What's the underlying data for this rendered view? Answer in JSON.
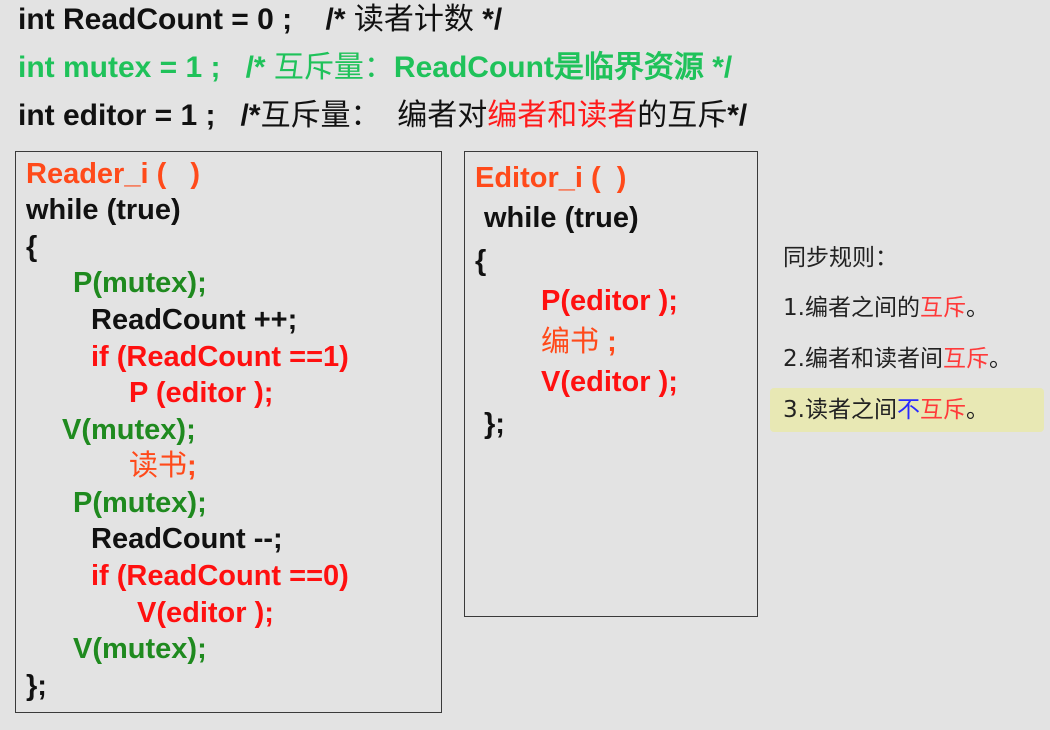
{
  "declarations": {
    "line1": {
      "code": "int ReadCount = 0 ;",
      "comment_open": "/* ",
      "comment_text": "读者计数",
      "comment_close": " */"
    },
    "line2": {
      "code": "int mutex = 1 ;",
      "comment_open": "/* ",
      "comment_text": "互斥量：",
      "comment_tail": "ReadCount",
      "comment_text2": "是临界资源",
      "comment_close": " */"
    },
    "line3": {
      "code": "int editor = 1 ;",
      "comment_open": "/*",
      "comment_text": "互斥量：  编者对",
      "comment_red": "编者和读者",
      "comment_text2": "的互斥",
      "comment_close": "*/"
    }
  },
  "reader": {
    "title": "Reader_i (   )",
    "while": "while (true)",
    "open_brace": "{",
    "l1": "P(mutex);",
    "l2": "ReadCount ++;",
    "l3": "if (ReadCount ==1)",
    "l4": "P (editor );",
    "l5": "V(mutex);",
    "l6_zh": "读书",
    "l6_semi": ";",
    "l7": "P(mutex);",
    "l8": "ReadCount --;",
    "l9": "if (ReadCount ==0)",
    "l10": "V(editor );",
    "l11": "V(mutex);",
    "close": "};"
  },
  "editor": {
    "title": "Editor_i (  )",
    "while": "while (true)",
    "open_brace": "{",
    "l1": "P(editor );",
    "l2_zh": "编书",
    "l2_semi": " ;",
    "l3": "V(editor );",
    "close": "};"
  },
  "rules": {
    "heading": "同步规则：",
    "r1_prefix": "1.编者之间的",
    "r1_red": "互斥",
    "r1_suffix": "。",
    "r2_prefix": "2.编者和读者间",
    "r2_red": "互斥",
    "r2_suffix": "。",
    "r3_prefix": "3.读者之间",
    "r3_blue": "不",
    "r3_red": "互斥",
    "r3_suffix": "。"
  }
}
